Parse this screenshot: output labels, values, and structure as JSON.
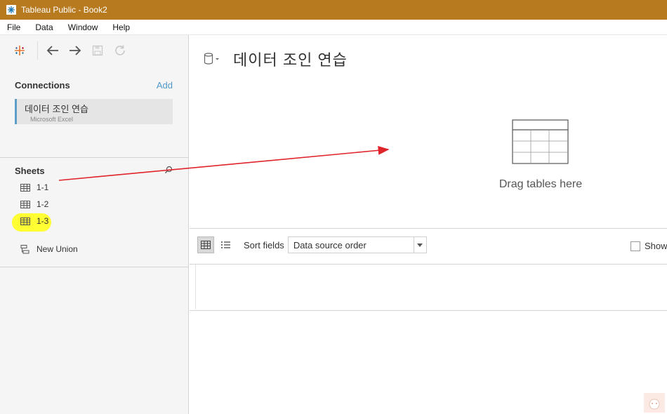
{
  "window": {
    "title": "Tableau Public - Book2"
  },
  "menu": [
    "File",
    "Data",
    "Window",
    "Help"
  ],
  "connections": {
    "title": "Connections",
    "add": "Add",
    "name": "데이터 조인 연습",
    "type": "Microsoft Excel"
  },
  "sheets": {
    "title": "Sheets",
    "items": [
      "1-1",
      "1-2",
      "1-3"
    ],
    "new_union": "New Union"
  },
  "datasource": {
    "title": "데이터 조인 연습",
    "drop_hint": "Drag tables here"
  },
  "grid": {
    "sort_label": "Sort fields",
    "sort_value": "Data source order",
    "show_label": "Show"
  },
  "colors": {
    "titlebar": "#b87a1e",
    "accent": "#4f99c8",
    "highlight": "#ffff33",
    "annotation": "#e0242b"
  }
}
